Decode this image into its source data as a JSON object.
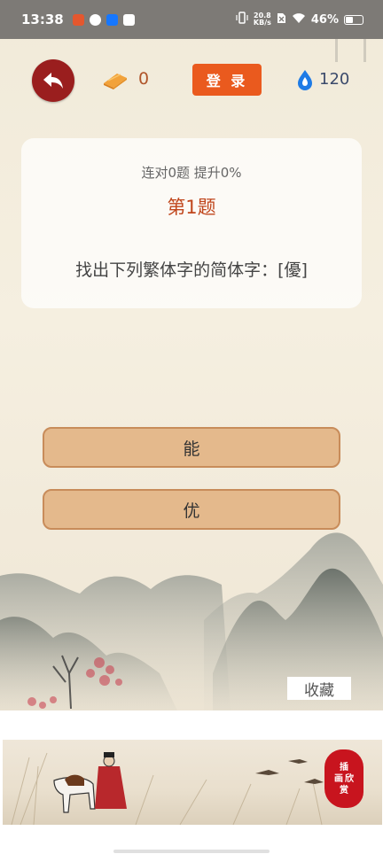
{
  "status_bar": {
    "time": "13:38",
    "net_speed_value": "20.8",
    "net_speed_unit": "KB/s",
    "battery_text": "46%",
    "battery_level": 0.46
  },
  "top_bar": {
    "coin_count": "0",
    "login_label": "登 录",
    "energy_count": "120"
  },
  "question": {
    "streak_text": "连对0题 提升0%",
    "number_text": "第1题",
    "prompt_text": "找出下列繁体字的简体字：[優]"
  },
  "options": [
    {
      "label": "能"
    },
    {
      "label": "优"
    }
  ],
  "favorite_label": "收藏",
  "banner": {
    "seal_text": [
      "插",
      "画",
      "欣",
      "赏"
    ]
  },
  "colors": {
    "back_button": "#9a1e1e",
    "login_button": "#ea5a1e",
    "question_number": "#c0461c",
    "option_fill": "#e4b98c",
    "option_border": "#c88c5a",
    "seal": "#c8141e"
  }
}
